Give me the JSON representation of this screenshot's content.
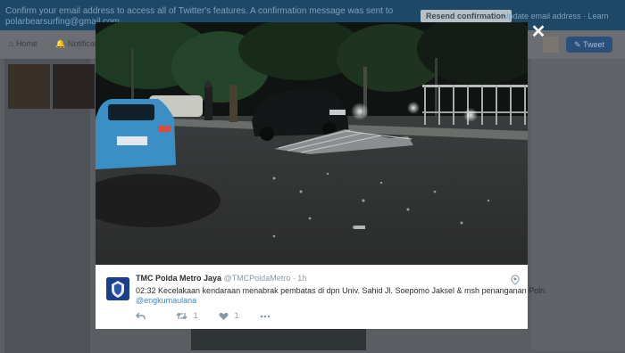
{
  "banner": {
    "message": "Confirm your email address to access all of Twitter's features. A confirmation message was sent to polarbearsurfing@gmail.com",
    "resend_label": "Resend confirmation",
    "update_label": "Update email address · Learn more"
  },
  "nav": {
    "home_label": "Home",
    "notifications_label": "Notifications",
    "tweet_label": "Tweet"
  },
  "tweet": {
    "author_name": "TMC Polda Metro Jaya",
    "author_handle": "@TMCPoldaMetro",
    "time": "· 1h",
    "text": "02:32 Kecelakaan kendaraan menabrak pembatas di dpn Univ. Sahid Jl. Soepomo Jaksel & msh penanganan Polri.",
    "mention": "@engkumaulana",
    "retweet_count": "1",
    "like_count": "1"
  },
  "icons": [
    "close-icon",
    "location-pin-icon",
    "reply-icon",
    "retweet-icon",
    "heart-icon",
    "more-icon"
  ],
  "colors": {
    "twitter_blue": "#3b88c3",
    "modal_bg": "#ffffff",
    "overlay": "#5a5e62"
  }
}
